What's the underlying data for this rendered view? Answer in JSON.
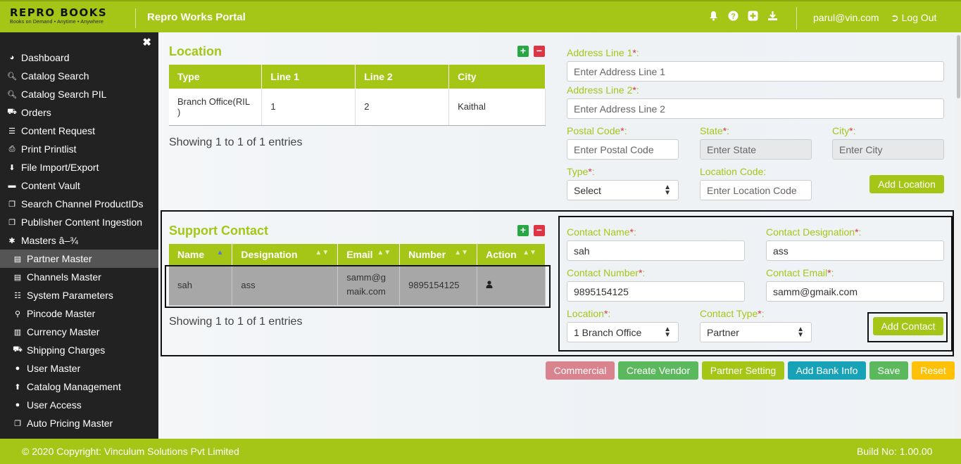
{
  "header": {
    "logo_main": "REPRO BOOKS",
    "logo_sub": "Books on Demand • Anytime • Anywhere",
    "portal_title": "Repro Works Portal",
    "icons": [
      "bell-icon",
      "question-icon",
      "plus-square-icon",
      "download-icon"
    ],
    "user_email": "parul@vin.com",
    "logout_label": "Log Out"
  },
  "sidebar": {
    "items": [
      {
        "label": "Dashboard",
        "icon": "dashboard-icon"
      },
      {
        "label": "Catalog Search",
        "icon": "search-icon"
      },
      {
        "label": "Catalog Search PIL",
        "icon": "search-icon"
      },
      {
        "label": "Orders",
        "icon": "cart-icon"
      },
      {
        "label": "Content Request",
        "icon": "list-icon"
      },
      {
        "label": "Print Printlist",
        "icon": "print-icon"
      },
      {
        "label": "File Import/Export",
        "icon": "download-icon"
      },
      {
        "label": "Content Vault",
        "icon": "folder-icon"
      },
      {
        "label": "Search Channel ProductIDs",
        "icon": "copy-icon"
      },
      {
        "label": "Publisher Content Ingestion",
        "icon": "copy-icon"
      },
      {
        "label": "Masters â–¾",
        "icon": "asterisk-icon"
      },
      {
        "label": "Partner Master",
        "icon": "id-card-icon"
      },
      {
        "label": "Channels Master",
        "icon": "id-card-icon"
      },
      {
        "label": "System Parameters",
        "icon": "list-ol-icon"
      },
      {
        "label": "Pincode Master",
        "icon": "pin-icon"
      },
      {
        "label": "Currency Master",
        "icon": "barcode-icon"
      },
      {
        "label": "Shipping Charges",
        "icon": "truck-icon"
      },
      {
        "label": "User Master",
        "icon": "user-icon"
      },
      {
        "label": "Catalog Management",
        "icon": "upload-icon"
      },
      {
        "label": "User Access",
        "icon": "user-icon"
      },
      {
        "label": "Auto Pricing Master",
        "icon": "copy-icon"
      }
    ]
  },
  "location": {
    "title": "Location",
    "columns": [
      "Type",
      "Line 1",
      "Line 2",
      "City"
    ],
    "rows": [
      [
        "Branch Office(RIL )",
        "1",
        "2",
        "Kaithal"
      ]
    ],
    "showing": "Showing 1 to 1 of 1 entries"
  },
  "address_form": {
    "address1_label": "Address Line 1",
    "address1_placeholder": "Enter Address Line 1",
    "address2_label": "Address Line 2",
    "address2_placeholder": "Enter Address Line 2",
    "postal_label": "Postal Code",
    "postal_placeholder": "Enter Postal Code",
    "state_label": "State",
    "state_placeholder": "Enter State",
    "city_label": "City",
    "city_placeholder": "Enter City",
    "type_label": "Type",
    "type_value": "Select",
    "location_code_label": "Location Code:",
    "location_code_placeholder": "Enter Location Code",
    "add_location_label": "Add Location",
    "required_mark": "*",
    "colon": ":"
  },
  "support_contact": {
    "title": "Support Contact",
    "columns": [
      "Name",
      "Designation",
      "Email",
      "Number",
      "Action"
    ],
    "rows": [
      {
        "name": "sah",
        "designation": "ass",
        "email": "samm@gmaik.com",
        "number": "9895154125",
        "action_icon": "user-icon"
      }
    ],
    "showing": "Showing 1 to 1 of 1 entries"
  },
  "contact_form": {
    "name_label": "Contact Name",
    "name_value": "sah",
    "designation_label": "Contact Designation",
    "designation_value": "ass",
    "number_label": "Contact Number",
    "number_value": "9895154125",
    "email_label": "Contact Email",
    "email_value": "samm@gmaik.com",
    "location_label": "Location",
    "location_value": "1 Branch Office",
    "contact_type_label": "Contact Type",
    "contact_type_value": "Partner",
    "add_contact_label": "Add Contact"
  },
  "actions": [
    {
      "label": "Commercial",
      "color": "#d9838f"
    },
    {
      "label": "Create Vendor",
      "color": "#5cb85c"
    },
    {
      "label": "Partner Setting",
      "color": "#a6c617"
    },
    {
      "label": "Add Bank Info",
      "color": "#17a2b8"
    },
    {
      "label": "Save",
      "color": "#5cb85c"
    },
    {
      "label": "Reset",
      "color": "#ffc107"
    }
  ],
  "footer": {
    "copyright": "© 2020 Copyright: Vinculum Solutions Pvt Limited",
    "build": "Build No: 1.00.00"
  },
  "colors": {
    "brand": "#a6c617",
    "sidebar": "#222222",
    "danger": "#dc3545",
    "success": "#28a745"
  }
}
